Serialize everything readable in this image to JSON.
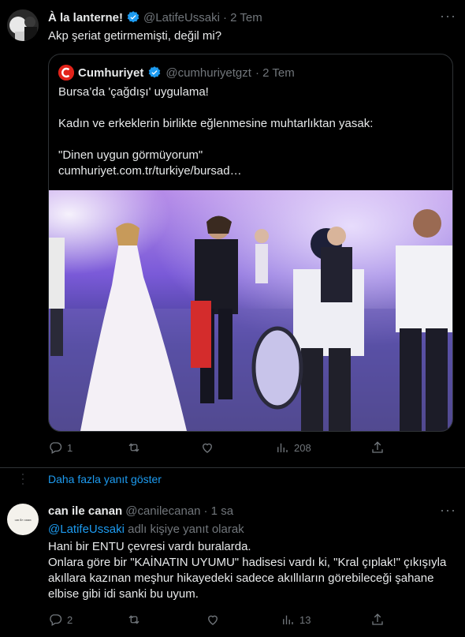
{
  "tweet1": {
    "name": "À la lanterne!",
    "handle": "@LatifeUssaki",
    "time": "· 2 Tem",
    "text": "Akp şeriat getirmemişti, değil mi?",
    "quote": {
      "name": "Cumhuriyet",
      "handle": "@cumhuriyetgzt",
      "time": "· 2 Tem",
      "line1": "Bursa’da 'çağdışı' uygulama!",
      "line2": "Kadın ve erkeklerin birlikte eğlenmesine muhtarlıktan yasak:",
      "line3": "\"Dinen uygun görmüyorum\"",
      "line4": "cumhuriyet.com.tr/turkiye/bursad…",
      "logo_letter": "C"
    },
    "actions": {
      "reply": "1",
      "retweet": "",
      "like": "",
      "views": "208"
    }
  },
  "show_more": "Daha fazla yanıt göster",
  "tweet2": {
    "name": "can ile canan",
    "handle": "@canilecanan",
    "time": "· 1 sa",
    "reply_to_handle": "@LatifeUssaki",
    "reply_to_suffix": " adlı kişiye yanıt olarak",
    "avatar_text": "can ile canan",
    "lines": [
      "Hani bir ENTU çevresi vardı buralarda.",
      "Onlara göre bir \"KAİNATIN UYUMU\" hadisesi vardı ki, \"Kral çıplak!\" çıkışıyla",
      "akıllara kazınan meşhur hikayedeki sadece akıllıların görebileceği şahane",
      "elbise gibi idi sanki bu uyum."
    ],
    "actions": {
      "reply": "2",
      "retweet": "",
      "like": "",
      "views": "13"
    }
  },
  "colors": {
    "accent": "#1d9bf0",
    "muted": "#71767b",
    "border": "#2f3336",
    "cumhuriyet_red": "#e2231a"
  }
}
